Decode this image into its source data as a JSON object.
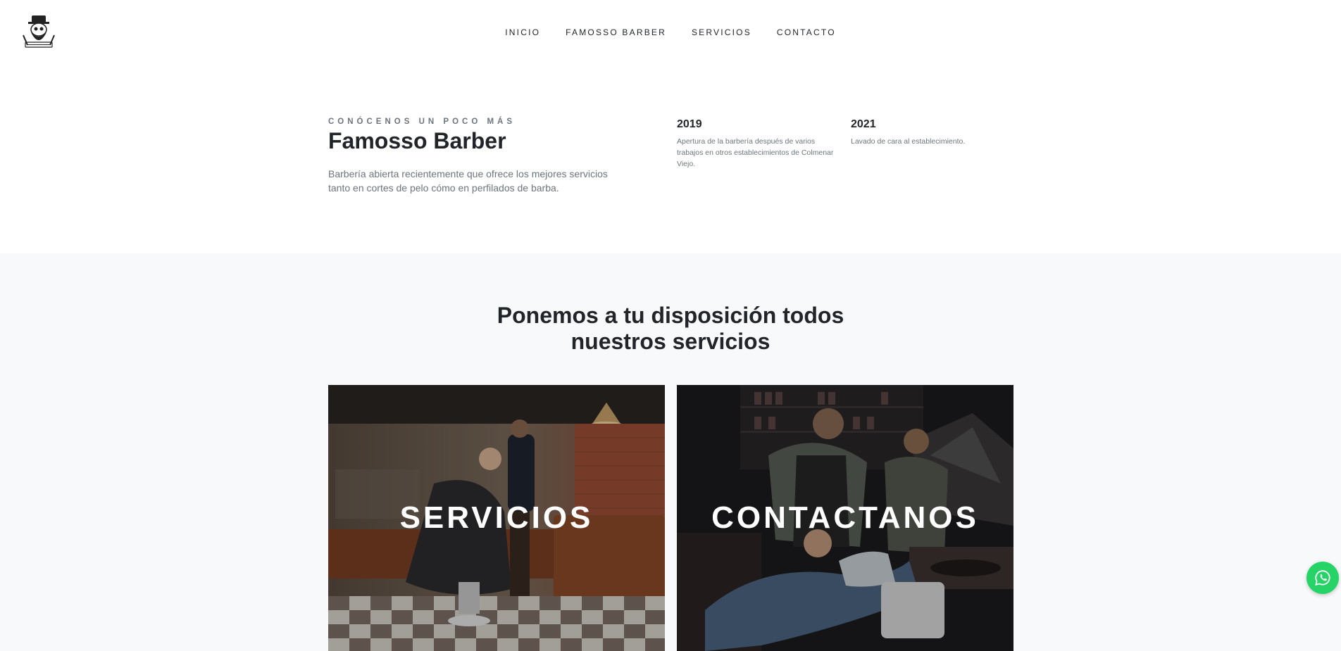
{
  "header": {
    "logo": {
      "icon": "bearded-skull-barber-logo"
    },
    "nav": [
      {
        "label": "INICIO"
      },
      {
        "label": "FAMOSSO BARBER"
      },
      {
        "label": "SERVICIOS"
      },
      {
        "label": "CONTACTO"
      }
    ]
  },
  "about": {
    "eyebrow": "CONÓCENOS UN POCO MÁS",
    "title": "Famosso Barber",
    "description": "Barbería abierta recientemente que ofrece los mejores servicios tanto en cortes de pelo cómo en perfilados de barba.",
    "milestones": [
      {
        "year": "2019",
        "text": "Apertura de la barbería después de varios trabajos en otros establecimientos de Colmenar Viejo."
      },
      {
        "year": "2021",
        "text": "Lavado de cara al establecimiento."
      }
    ]
  },
  "services": {
    "title_line1": "Ponemos a tu disposición todos",
    "title_line2": "nuestros servicios",
    "cards": [
      {
        "label": "SERVICIOS",
        "image": "barber-shop-haircut-photo"
      },
      {
        "label": "CONTACTANOS",
        "image": "barber-shaving-client-photo"
      }
    ]
  },
  "whatsapp": {
    "icon": "whatsapp-icon",
    "color": "#25d366"
  },
  "colors": {
    "muted": "#6c757d",
    "dark": "#212529",
    "section_bg": "#f8f9fa"
  }
}
